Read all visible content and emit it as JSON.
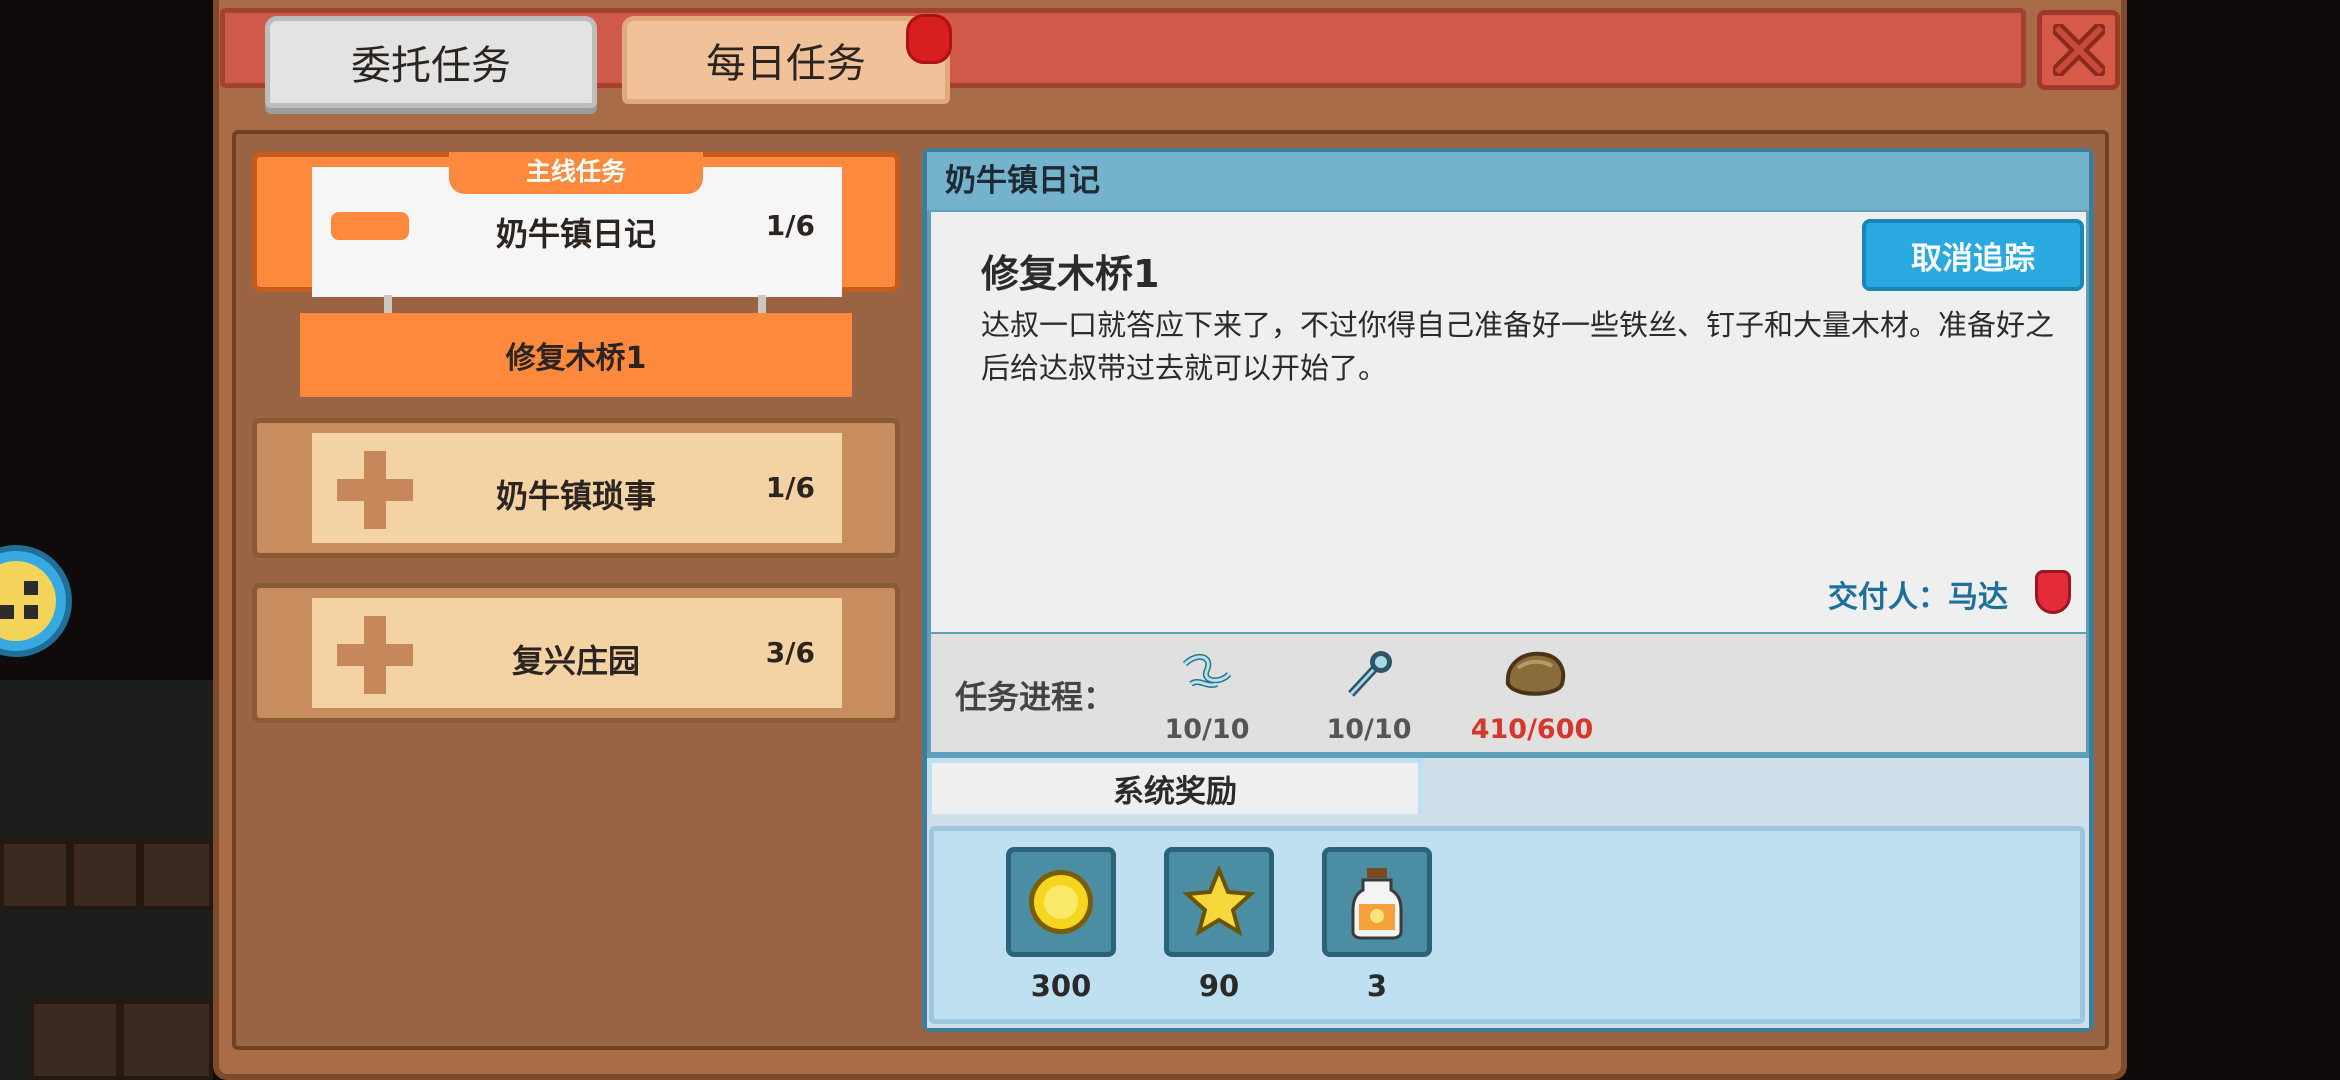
{
  "tabs": [
    {
      "label": "委托任务",
      "active": true
    },
    {
      "label": "每日任务",
      "active": false,
      "has_badge": true
    }
  ],
  "quest_list": {
    "main_tag": "主线任务",
    "categories": [
      {
        "name": "奶牛镇日记",
        "progress": "1/6",
        "expanded": true
      },
      {
        "name": "奶牛镇琐事",
        "progress": "1/6",
        "expanded": false
      },
      {
        "name": "复兴庄园",
        "progress": "3/6",
        "expanded": false
      }
    ],
    "selected_sub_quest": "修复木桥1"
  },
  "detail": {
    "header": "奶牛镇日记",
    "quest_title": "修复木桥1",
    "description": "达叔一口就答应下来了，不过你得自己准备好一些铁丝、钉子和大量木材。准备好之后给达叔带过去就可以开始了。",
    "cancel_label": "取消追踪",
    "giver_label": "交付人：马达",
    "progress_label": "任务进程：",
    "requirements": [
      {
        "icon": "wire-icon",
        "value": "10/10",
        "complete": true
      },
      {
        "icon": "hammer-icon",
        "value": "10/10",
        "complete": true
      },
      {
        "icon": "wood-icon",
        "value": "410/600",
        "complete": false
      }
    ],
    "reward_tab": "系统奖励",
    "rewards": [
      {
        "icon": "gold-coin-icon",
        "value": "300"
      },
      {
        "icon": "star-icon",
        "value": "90"
      },
      {
        "icon": "potion-bottle-icon",
        "value": "3"
      }
    ]
  },
  "colors": {
    "accent_orange": "#ff8a3d",
    "title_red": "#cf5a49",
    "detail_blue": "#5e9fb9",
    "incomplete_red": "#d6362b"
  }
}
